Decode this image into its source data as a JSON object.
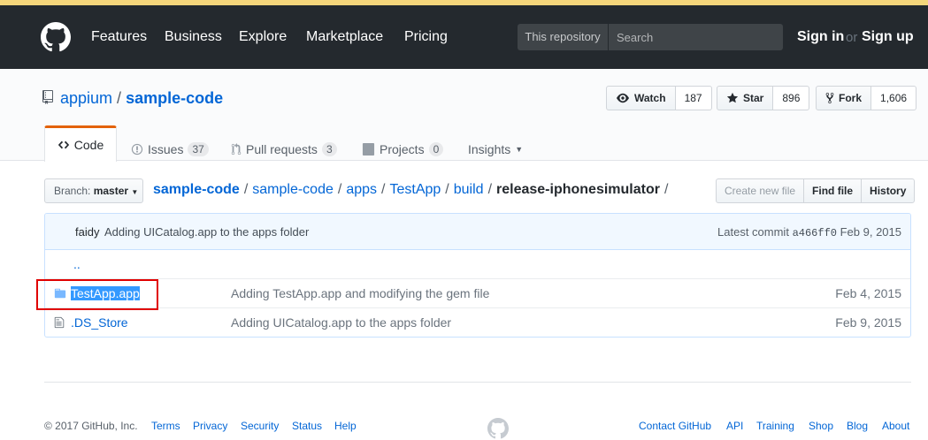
{
  "header": {
    "nav": [
      "Features",
      "Business",
      "Explore",
      "Marketplace",
      "Pricing"
    ],
    "search_scope": "This repository",
    "search_placeholder": "Search",
    "sign_in": "Sign in",
    "or": "or",
    "sign_up": "Sign up"
  },
  "repo": {
    "owner": "appium",
    "separator": "/",
    "name": "sample-code",
    "watch_label": "Watch",
    "watch_count": "187",
    "star_label": "Star",
    "star_count": "896",
    "fork_label": "Fork",
    "fork_count": "1,606"
  },
  "tabs": {
    "code": "Code",
    "issues": "Issues",
    "issues_count": "37",
    "pulls": "Pull requests",
    "pulls_count": "3",
    "projects": "Projects",
    "projects_count": "0",
    "insights": "Insights"
  },
  "branch": {
    "label": "Branch:",
    "value": "master"
  },
  "breadcrumb": [
    "sample-code",
    "sample-code",
    "apps",
    "TestApp",
    "build"
  ],
  "breadcrumb_final": "release-iphonesimulator",
  "breadcrumb_trailing": "/",
  "file_buttons": {
    "create": "Create new file",
    "find": "Find file",
    "history": "History"
  },
  "commit": {
    "author": "faidy",
    "message": "Adding UICatalog.app to the apps folder",
    "latest_label": "Latest commit",
    "sha": "a466ff0",
    "date": "Feb 9, 2015"
  },
  "files": [
    {
      "name": "..",
      "type": "up",
      "message": "",
      "age": ""
    },
    {
      "name": "TestApp.app",
      "type": "folder",
      "message": "Adding TestApp.app and modifying the gem file",
      "age": "Feb 4, 2015"
    },
    {
      "name": ".DS_Store",
      "type": "file",
      "message": "Adding UICatalog.app to the apps folder",
      "age": "Feb 9, 2015"
    }
  ],
  "footer": {
    "copyright": "© 2017 GitHub, Inc.",
    "left_links": [
      "Terms",
      "Privacy",
      "Security",
      "Status",
      "Help"
    ],
    "right_links": [
      "Contact GitHub",
      "API",
      "Training",
      "Shop",
      "Blog",
      "About"
    ]
  },
  "colors": {
    "header_bg": "#24292e",
    "link": "#0366d6",
    "tab_accent": "#e36209",
    "highlight_box": "#e00000",
    "selection": "#3399ff"
  },
  "icons": [
    "github-logo-icon",
    "repo-icon",
    "eye-icon",
    "star-icon",
    "fork-icon",
    "code-icon",
    "issue-icon",
    "pull-request-icon",
    "project-icon",
    "folder-icon",
    "file-icon"
  ]
}
